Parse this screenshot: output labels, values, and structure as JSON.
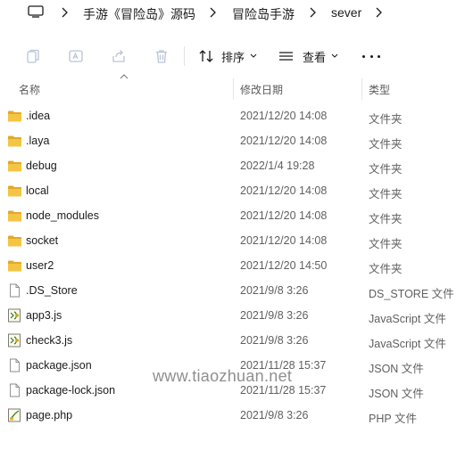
{
  "breadcrumb": {
    "items": [
      "手游《冒险岛》源码",
      "冒险岛手游",
      "sever"
    ]
  },
  "toolbar": {
    "sort_label": "排序",
    "view_label": "查看"
  },
  "columns": {
    "name": "名称",
    "date": "修改日期",
    "type": "类型"
  },
  "files": [
    {
      "name": ".idea",
      "date": "2021/12/20 14:08",
      "type": "文件夹",
      "icon": "folder-icon"
    },
    {
      "name": ".laya",
      "date": "2021/12/20 14:08",
      "type": "文件夹",
      "icon": "folder-icon"
    },
    {
      "name": "debug",
      "date": "2022/1/4 19:28",
      "type": "文件夹",
      "icon": "folder-icon"
    },
    {
      "name": "local",
      "date": "2021/12/20 14:08",
      "type": "文件夹",
      "icon": "folder-icon"
    },
    {
      "name": "node_modules",
      "date": "2021/12/20 14:08",
      "type": "文件夹",
      "icon": "folder-icon"
    },
    {
      "name": "socket",
      "date": "2021/12/20 14:08",
      "type": "文件夹",
      "icon": "folder-icon"
    },
    {
      "name": "user2",
      "date": "2021/12/20 14:50",
      "type": "文件夹",
      "icon": "folder-icon"
    },
    {
      "name": ".DS_Store",
      "date": "2021/9/8 3:26",
      "type": "DS_STORE 文件",
      "icon": "file-icon"
    },
    {
      "name": "app3.js",
      "date": "2021/9/8 3:26",
      "type": "JavaScript 文件",
      "icon": "js-file-icon"
    },
    {
      "name": "check3.js",
      "date": "2021/9/8 3:26",
      "type": "JavaScript 文件",
      "icon": "js-file-icon"
    },
    {
      "name": "package.json",
      "date": "2021/11/28 15:37",
      "type": "JSON 文件",
      "icon": "file-icon"
    },
    {
      "name": "package-lock.json",
      "date": "2021/11/28 15:37",
      "type": "JSON 文件",
      "icon": "file-icon"
    },
    {
      "name": "page.php",
      "date": "2021/9/8 3:26",
      "type": "PHP 文件",
      "icon": "php-file-icon"
    }
  ],
  "watermark": "www.tiaozhuan.net",
  "colors": {
    "folder": "#f4c542",
    "folder_dark": "#e2a82a",
    "disabled_icon": "#b8c4d6"
  }
}
